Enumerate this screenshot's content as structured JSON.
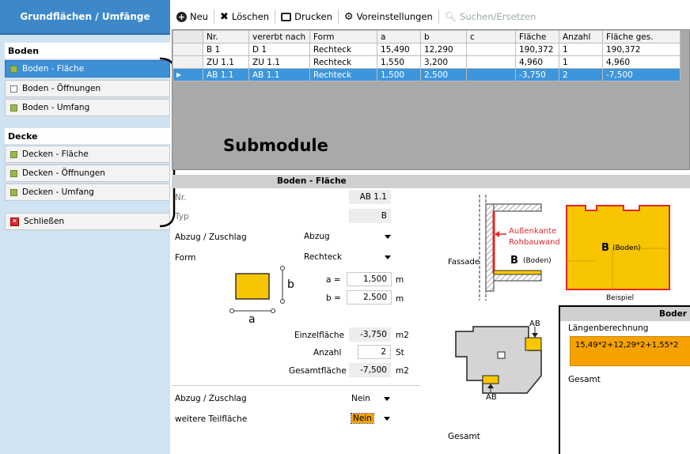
{
  "sidebar": {
    "title": "Grundflächen / Umfänge",
    "boden_label": "Boden",
    "boden_items": [
      {
        "label": "Boden - Fläche",
        "icon": "green-square-icon",
        "active": true
      },
      {
        "label": "Boden - Öffnungen",
        "icon": "white-square-icon",
        "active": false
      },
      {
        "label": "Boden - Umfang",
        "icon": "green-square-icon",
        "active": false
      }
    ],
    "decke_label": "Decke",
    "decke_items": [
      {
        "label": "Decken - Fläche",
        "icon": "green-square-icon"
      },
      {
        "label": "Decken - Öffnungen",
        "icon": "green-square-icon"
      },
      {
        "label": "Decken - Umfang",
        "icon": "green-square-icon"
      }
    ],
    "close_label": "Schließen",
    "close_icon": "red-x-icon"
  },
  "annotation": "Submodule",
  "toolbar": {
    "new": "Neu",
    "delete": "Löschen",
    "print": "Drucken",
    "settings": "Voreinstellungen",
    "search": "Suchen/Ersetzen"
  },
  "grid": {
    "columns": [
      "Nr.",
      "vererbt nach",
      "Form",
      "a",
      "b",
      "c",
      "Fläche",
      "Anzahl",
      "Fläche ges."
    ],
    "rows": [
      [
        "B 1",
        "D 1",
        "Rechteck",
        "15,490",
        "12,290",
        "",
        "190,372",
        "1",
        "190,372"
      ],
      [
        "ZU 1.1",
        "ZU 1.1",
        "Rechteck",
        "1,550",
        "3,200",
        "",
        "4,960",
        "1",
        "4,960"
      ],
      [
        "AB 1.1",
        "AB 1.1",
        "Rechteck",
        "1,500",
        "2,500",
        "",
        "-3,750",
        "2",
        "-7,500"
      ]
    ],
    "selected_row": 2
  },
  "panel": {
    "title": "Boden - Fläche",
    "nr_label": "Nr.",
    "nr_value": "AB 1.1",
    "typ_label": "Typ",
    "typ_value": "B",
    "abzug_label": "Abzug / Zuschlag",
    "abzug_value": "Abzug",
    "form_label": "Form",
    "form_value": "Rechteck",
    "a_label": "a =",
    "a_value": "1,500",
    "a_unit": "m",
    "b_label": "b =",
    "b_value": "2,500",
    "b_unit": "m",
    "einzel_label": "Einzelfläche",
    "einzel_value": "-3,750",
    "einzel_unit": "m2",
    "anzahl_label": "Anzahl",
    "anzahl_value": "2",
    "anzahl_unit": "St",
    "gesamt_label": "Gesamtfläche",
    "gesamt_value": "-7,500",
    "gesamt_unit": "m2",
    "abzug2_label": "Abzug / Zuschlag",
    "abzug2_value": "Nein",
    "weitere_label": "weitere Teilfläche",
    "weitere_value": "Nein",
    "gesamt_bottom": "Gesamt"
  },
  "diagram": {
    "rect_a": "a",
    "rect_b": "b",
    "fassade": "Fassade",
    "aussenkante": "Außenkante",
    "rohbauwand": "Rohbauwand",
    "b_boden": "B",
    "boden_paren": "(Boden)",
    "plan_b": "B",
    "plan_boden": "(Boden)",
    "beispiel": "Beispiel",
    "ab_top": "AB",
    "ab_bottom": "AB"
  },
  "rightbox": {
    "header": "Boder",
    "laengen_label": "Längenberechnung",
    "formula": "15,49*2+12,29*2+1,55*2",
    "gesamt_label": "Gesamt"
  },
  "colors": {
    "accent": "#3d88c9",
    "selection": "#3d96dc",
    "yellow": "#f7c600",
    "orange": "#f5a200",
    "red": "#e0262b"
  }
}
